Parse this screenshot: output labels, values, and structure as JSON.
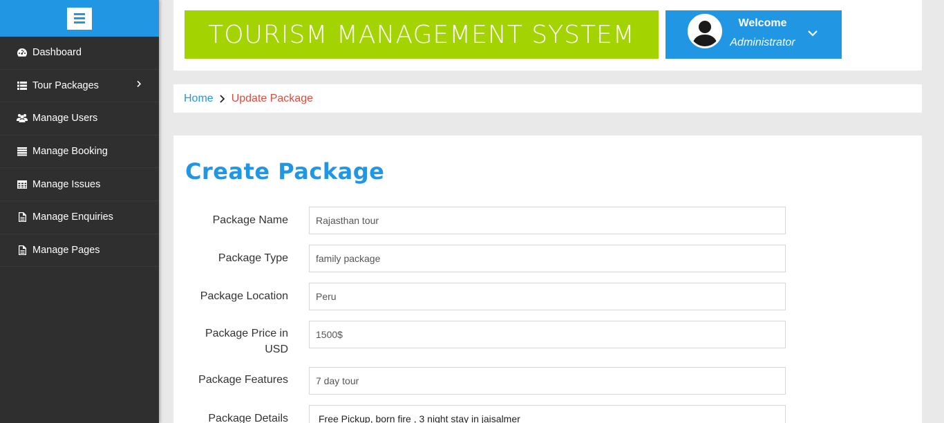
{
  "sidebar": {
    "menu_icon": "hamburger-icon",
    "items": [
      {
        "label": "Dashboard",
        "icon": "dashboard-icon"
      },
      {
        "label": "Tour Packages",
        "icon": "list-icon"
      },
      {
        "label": "Manage Users",
        "icon": "users-icon"
      },
      {
        "label": "Manage Booking",
        "icon": "list-icon"
      },
      {
        "label": "Manage Issues",
        "icon": "table-icon"
      },
      {
        "label": "Manage Enquiries",
        "icon": "document-icon"
      },
      {
        "label": "Manage Pages",
        "icon": "document-icon"
      }
    ]
  },
  "header": {
    "title": "TOURISM MANAGEMENT SYSTEM",
    "welcome": "Welcome",
    "role": "Administrator"
  },
  "breadcrumb": {
    "home": "Home",
    "current": "Update Package"
  },
  "form": {
    "title": "Create Package",
    "fields": [
      {
        "label": "Package Name",
        "value": "Rajasthan tour"
      },
      {
        "label": "Package Type",
        "value": "family package"
      },
      {
        "label": "Package Location",
        "value": "Peru"
      },
      {
        "label": "Package Price in USD",
        "value": "1500$"
      },
      {
        "label": "Package Features",
        "value": "7 day tour"
      },
      {
        "label": "Package Details",
        "value": "Free Pickup, born fire , 3 night stay in jaisalmer"
      }
    ]
  },
  "colors": {
    "accent": "#2196e3",
    "title_bg": "#a3d300",
    "sidebar_bg": "#2f2f2f",
    "breadcrumb_current": "#e04a3c"
  }
}
